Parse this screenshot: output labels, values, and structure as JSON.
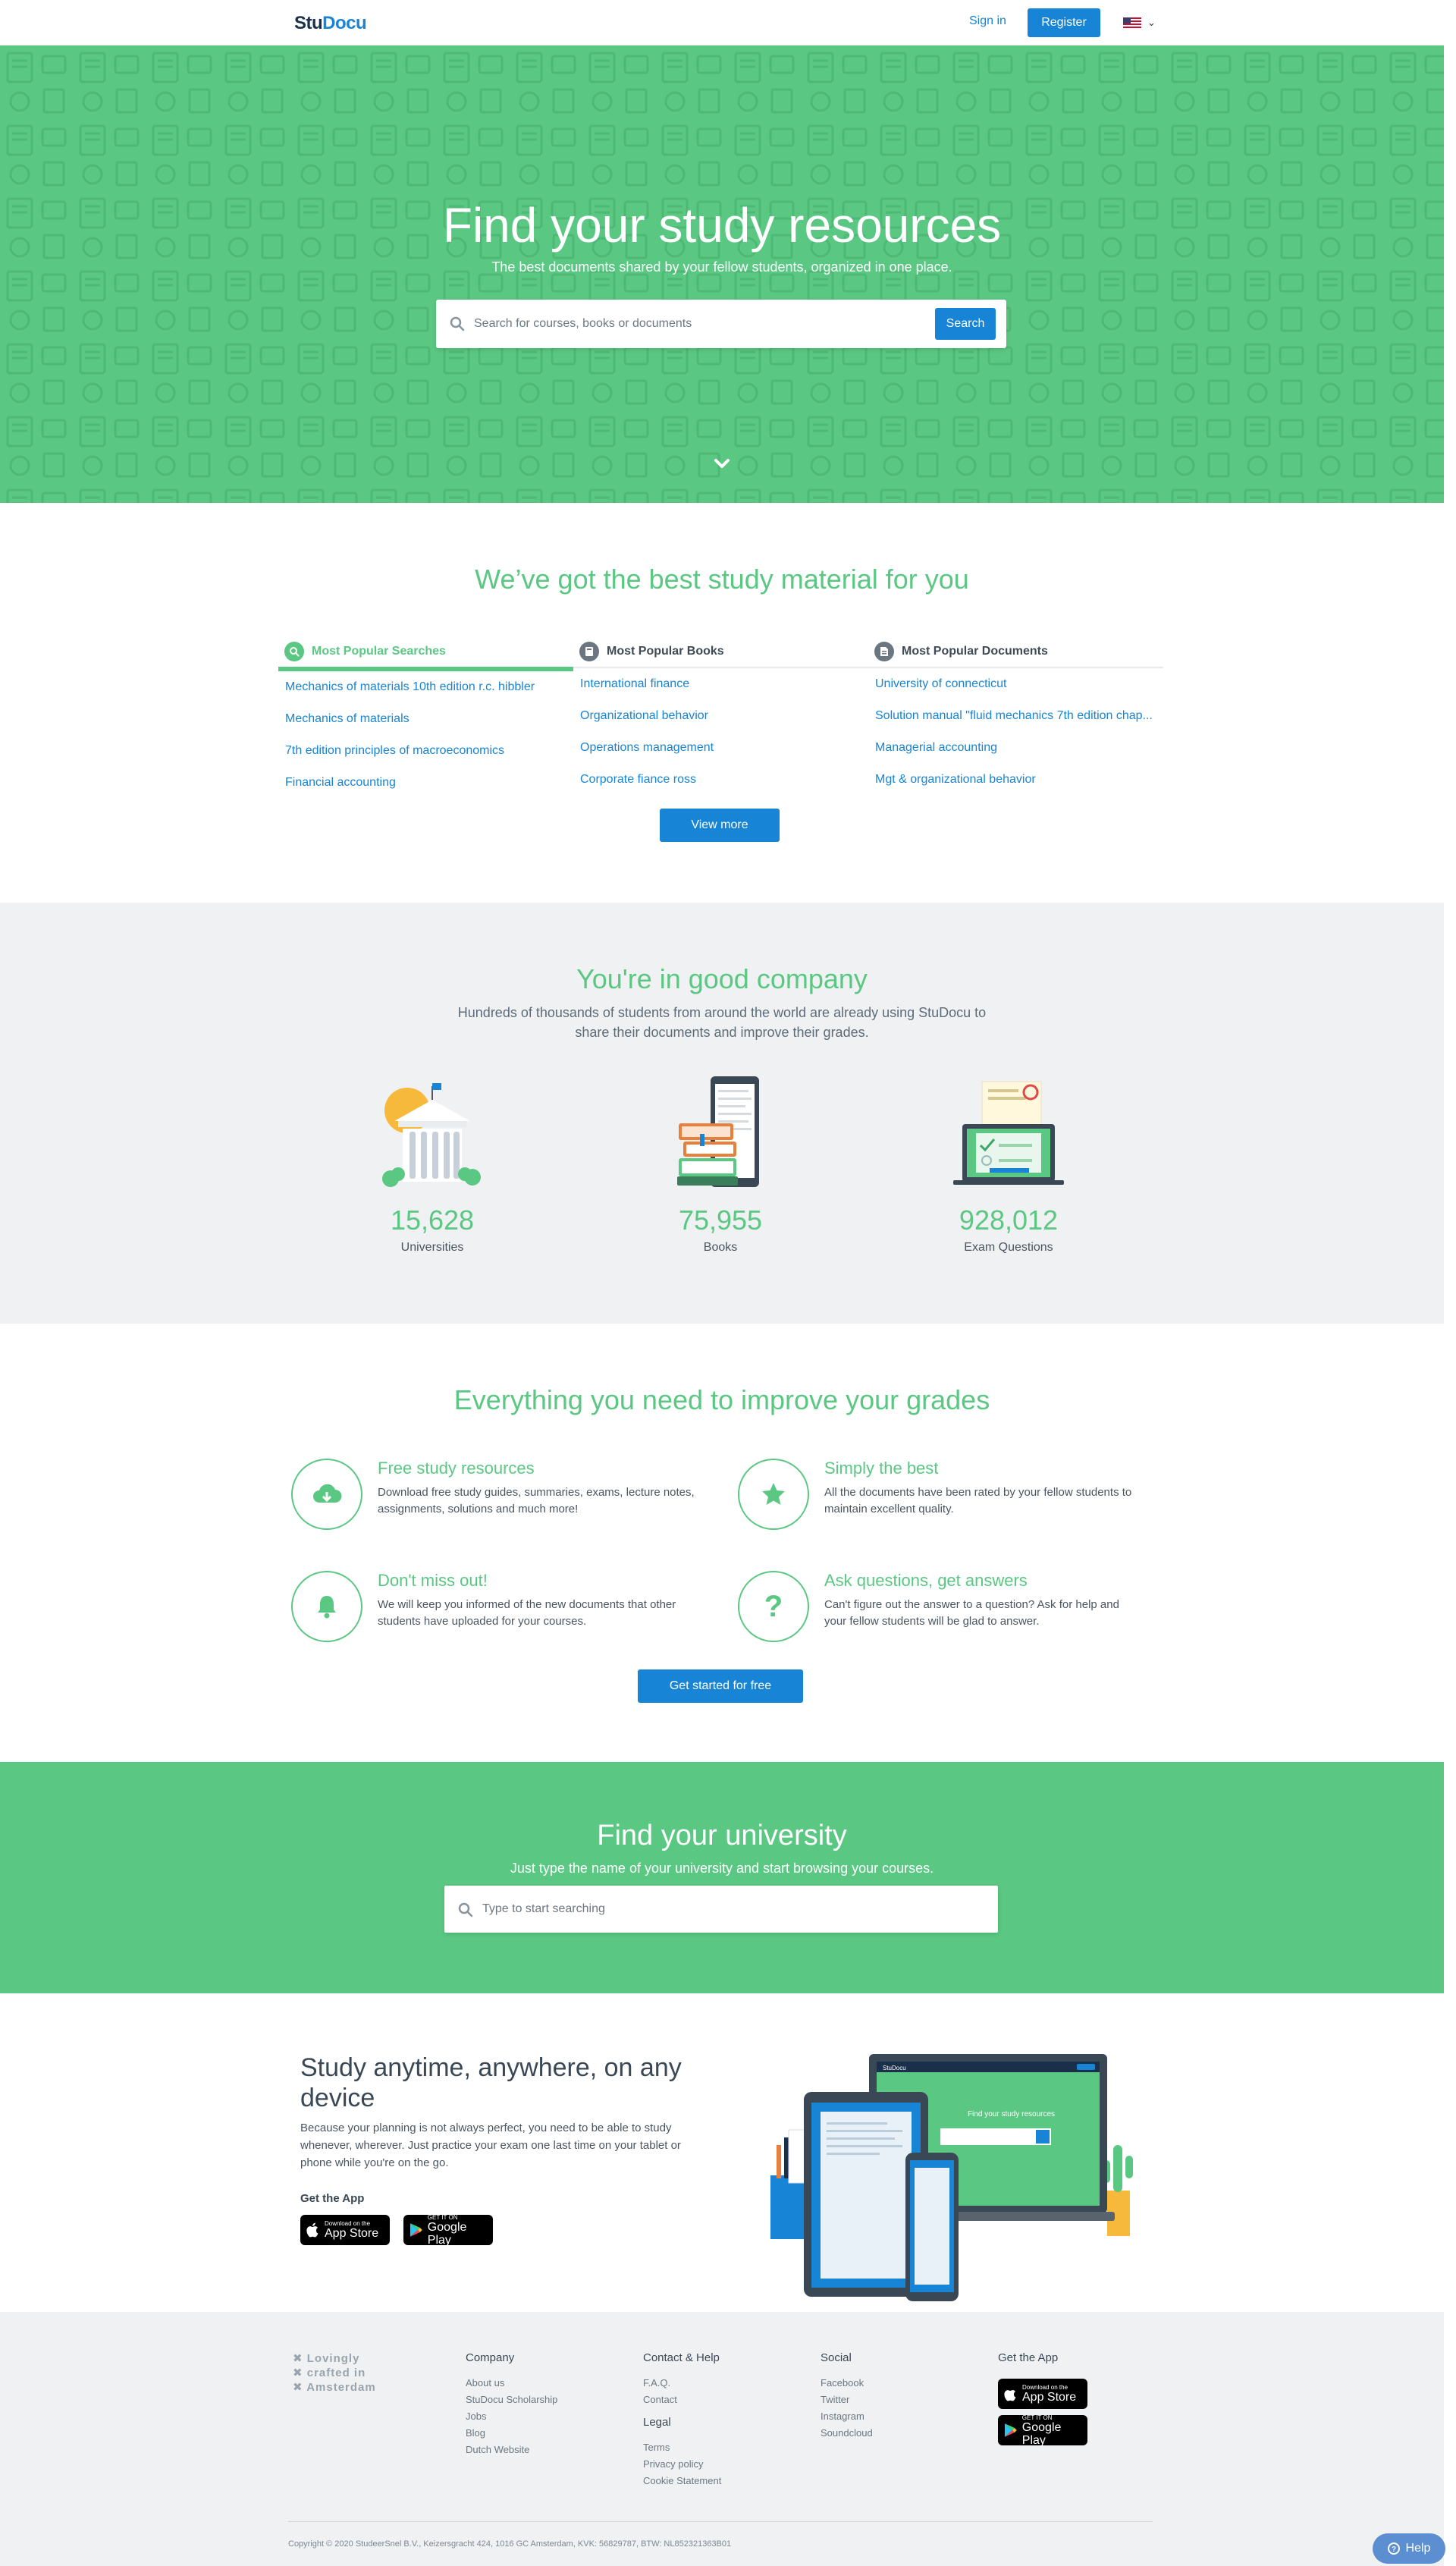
{
  "header": {
    "logo_part1": "Stu",
    "logo_part2": "Docu",
    "signin_label": "Sign in",
    "register_label": "Register"
  },
  "hero": {
    "title": "Find your study resources",
    "subtitle": "The best documents shared by your fellow students, organized in one place.",
    "search_placeholder": "Search for courses, books or documents",
    "search_button": "Search"
  },
  "material": {
    "title": "We’ve got the best study material for you",
    "columns": [
      {
        "heading": "Most Popular Searches",
        "items": [
          "Mechanics of materials 10th edition r.c. hibbler",
          "Mechanics of materials",
          "7th edition principles of macroeconomics",
          "Financial accounting"
        ]
      },
      {
        "heading": "Most Popular Books",
        "items": [
          "International finance",
          "Organizational behavior",
          "Operations management",
          "Corporate fiance ross"
        ]
      },
      {
        "heading": "Most Popular Documents",
        "items": [
          "University of connecticut",
          "Solution manual \"fluid mechanics 7th edition chap...",
          "Managerial accounting",
          "Mgt & organizational behavior"
        ]
      }
    ],
    "view_more": "View more"
  },
  "company": {
    "title": "You're in good company",
    "description": "Hundreds of thousands of students from around the world are already using StuDocu to share their documents and improve their grades.",
    "stats": [
      {
        "value": "15,628",
        "label": "Universities"
      },
      {
        "value": "75,955",
        "label": "Books"
      },
      {
        "value": "928,012",
        "label": "Exam Questions"
      }
    ]
  },
  "features": {
    "title": "Everything you need to improve your grades",
    "items": [
      {
        "title": "Free study resources",
        "text": "Download free study guides, summaries, exams, lecture notes, assignments, solutions and much more!"
      },
      {
        "title": "Simply the best",
        "text": "All the documents have been rated by your fellow students to maintain excellent quality."
      },
      {
        "title": "Don't miss out!",
        "text": "We will keep you informed of the new documents that other students have uploaded for your courses."
      },
      {
        "title": "Ask questions, get answers",
        "text": "Can't figure out the answer to a question? Ask for help and your fellow students will be glad to answer."
      }
    ],
    "cta": "Get started for free"
  },
  "university": {
    "title": "Find your university",
    "subtitle": "Just type the name of your university and start browsing your courses.",
    "placeholder": "Type to start searching"
  },
  "device": {
    "title": "Study anytime, anywhere, on any device",
    "text": "Because your planning is not always perfect, you need to be able to study whenever, wherever. Just practice your exam one last time on your tablet or phone while you're on the go.",
    "get_app": "Get the App",
    "appstore_small": "Download on the",
    "appstore_big": "App Store",
    "googleplay_small": "GET IT ON",
    "googleplay_big": "Google Play",
    "laptop_brand": "StuDocu",
    "laptop_hero": "Find your study resources"
  },
  "footer": {
    "tagline": [
      "Lovingly",
      "crafted in",
      "Amsterdam"
    ],
    "company_heading": "Company",
    "company_links": [
      "About us",
      "StuDocu Scholarship",
      "Jobs",
      "Blog",
      "Dutch Website"
    ],
    "contact_heading": "Contact & Help",
    "contact_links": [
      "F.A.Q.",
      "Contact"
    ],
    "legal_heading": "Legal",
    "legal_links": [
      "Terms",
      "Privacy policy",
      "Cookie Statement"
    ],
    "social_heading": "Social",
    "social_links": [
      "Facebook",
      "Twitter",
      "Instagram",
      "Soundcloud"
    ],
    "app_heading": "Get the App",
    "copyright": "Copyright © 2020 StudeerSnel B.V., Keizersgracht 424, 1016 GC Amsterdam, KVK: 56829787, BTW: NL852321363B01"
  },
  "help_label": "Help",
  "colors": {
    "brand_green": "#5ac782",
    "brand_blue": "#1884d6",
    "navy": "#1a2f4a"
  },
  "icons": [
    "search-icon",
    "book-icon",
    "document-icon",
    "chevron-down-icon",
    "download-cloud-icon",
    "star-icon",
    "bell-icon",
    "question-icon",
    "apple-icon",
    "play-icon",
    "flag-us-icon",
    "help-icon"
  ]
}
